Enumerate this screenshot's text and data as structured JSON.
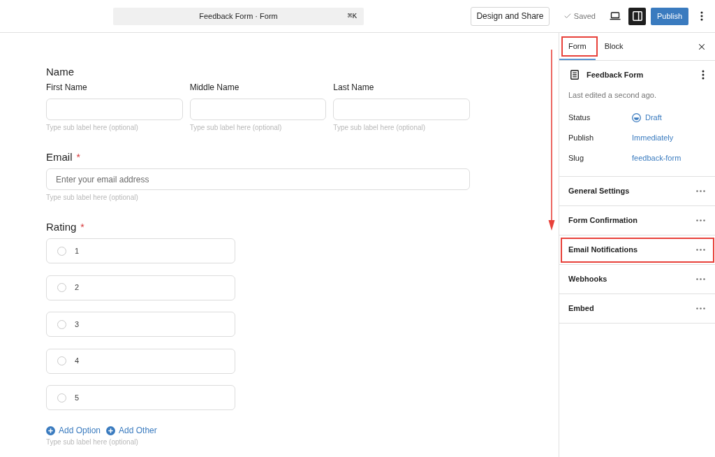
{
  "top_bar": {
    "command_bar": {
      "title": "Feedback Form · Form",
      "shortcut": "⌘K"
    },
    "design_button": "Design and Share",
    "save_status": "Saved",
    "sidebar_toggle": {
      "on": true
    },
    "publish_button": "Publish"
  },
  "form": {
    "name_field": {
      "label": "Name",
      "parts": [
        {
          "label": "First Name",
          "hint": "Type sub label here (optional)"
        },
        {
          "label": "Middle Name",
          "hint": "Type sub label here (optional)"
        },
        {
          "label": "Last Name",
          "hint": "Type sub label here (optional)"
        }
      ]
    },
    "email_field": {
      "label": "Email",
      "required_mark": "*",
      "placeholder": "Enter your email address",
      "hint": "Type sub label here (optional)"
    },
    "rating_field": {
      "label": "Rating",
      "required_mark": "*",
      "options": [
        {
          "label": "1",
          "selected": false
        },
        {
          "label": "2",
          "selected": false
        },
        {
          "label": "3",
          "selected": false
        },
        {
          "label": "4",
          "selected": false
        },
        {
          "label": "5",
          "selected": false
        }
      ],
      "actions": [
        "Add Option",
        "Add Other"
      ],
      "hint": "Type sub label here (optional)"
    }
  },
  "sidebar": {
    "tabs": [
      {
        "label": "Form",
        "selected": true,
        "highlighted": true
      },
      {
        "label": "Block",
        "selected": false,
        "highlighted": false
      }
    ],
    "form_card": {
      "title": "Feedback Form",
      "last_edited": "Last edited a second ago.",
      "rows": [
        {
          "kind": "status",
          "label": "Status",
          "value": "Draft"
        },
        {
          "kind": "link",
          "label": "Publish",
          "value": "Immediately"
        },
        {
          "kind": "link",
          "label": "Slug",
          "value": "feedback-form"
        }
      ]
    },
    "sections": [
      {
        "title": "General Settings",
        "highlighted": false
      },
      {
        "title": "Form Confirmation",
        "highlighted": false
      },
      {
        "title": "Email Notifications",
        "highlighted": true
      },
      {
        "title": "Webhooks",
        "highlighted": false
      },
      {
        "title": "Embed",
        "highlighted": false
      }
    ]
  },
  "annotation_arrow": true
}
